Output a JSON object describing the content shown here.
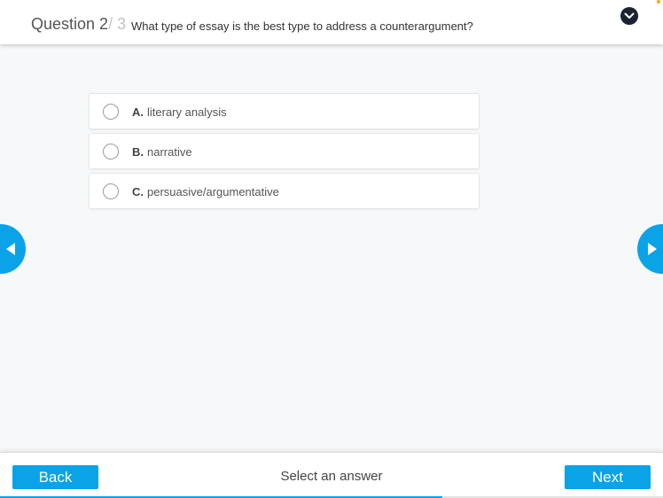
{
  "header": {
    "question_label": "Question 2",
    "question_total": "/ 3",
    "question_text": "What type of essay is the best type to address a counterargument?",
    "collapse_icon": "chevron-down-icon"
  },
  "options": [
    {
      "letter": "A.",
      "text": "literary analysis"
    },
    {
      "letter": "B.",
      "text": "narrative"
    },
    {
      "letter": "C.",
      "text": "persuasive/argumentative"
    }
  ],
  "nav": {
    "prev_icon": "arrow-left-icon",
    "next_icon": "arrow-right-icon"
  },
  "footer": {
    "back_label": "Back",
    "status_text": "Select an answer",
    "next_label": "Next",
    "progress_fraction": 0.667
  },
  "colors": {
    "accent": "#0aa3e8",
    "header_icon_bg": "#1a2233"
  }
}
